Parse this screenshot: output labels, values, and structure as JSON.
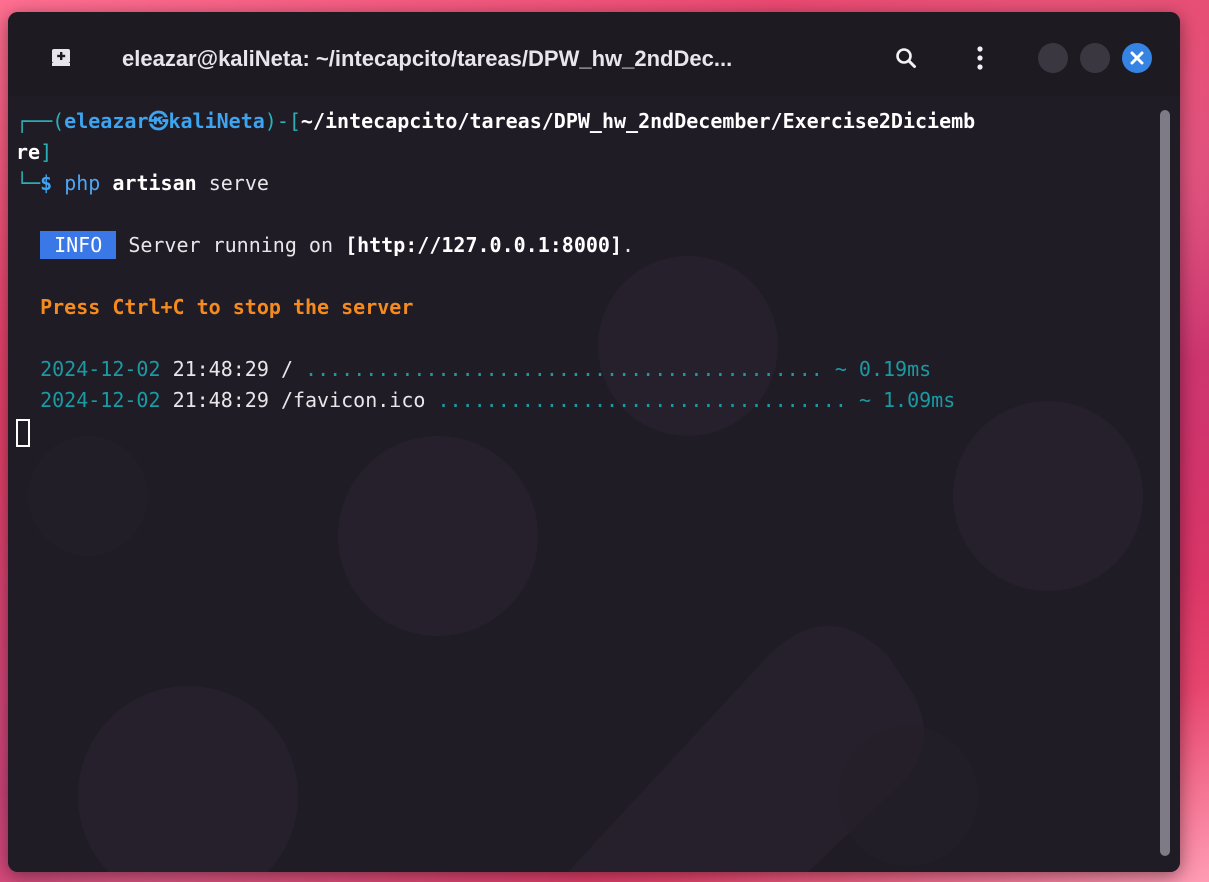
{
  "window": {
    "title": "eleazar@kaliNeta: ~/intecapcito/tareas/DPW_hw_2ndDec...",
    "icons": {
      "new_tab": "new-tab-icon",
      "search": "search-icon",
      "menu": "vertical-dots-icon",
      "close": "close-icon"
    }
  },
  "colors": {
    "prompt_green": "#2bb0b8",
    "user_blue": "#3ca4f0",
    "info_badge": "#3b78e7",
    "warning_orange": "#f58b1f",
    "close_button": "#3584e4"
  },
  "terminal": {
    "prompt": {
      "prefix": "┌──(",
      "user": "eleazar",
      "at_symbol": "㉿",
      "host": "kaliNeta",
      "bracket_mid": ")-[",
      "path_line1": "~/intecapcito/tareas/DPW_hw_2ndDecember/Exercise2Diciemb",
      "path_line2": "re",
      "bracket_close": "]",
      "corner": "└─",
      "dollar": "$ ",
      "cmd": "php",
      "arg1": "artisan",
      "arg2": "serve"
    },
    "info": {
      "badge": "INFO",
      "text": "Server running on ",
      "url": "[http://127.0.0.1:8000]",
      "end": "."
    },
    "stop_message": "Press Ctrl+C to stop the server",
    "log": [
      {
        "date": "2024-12-02",
        "time": "21:48:29",
        "path": "/",
        "dots": "...........................................",
        "duration": "~ 0.19ms"
      },
      {
        "date": "2024-12-02",
        "time": "21:48:29",
        "path": "/favicon.ico",
        "dots": "..................................",
        "duration": "~ 1.09ms"
      }
    ]
  }
}
